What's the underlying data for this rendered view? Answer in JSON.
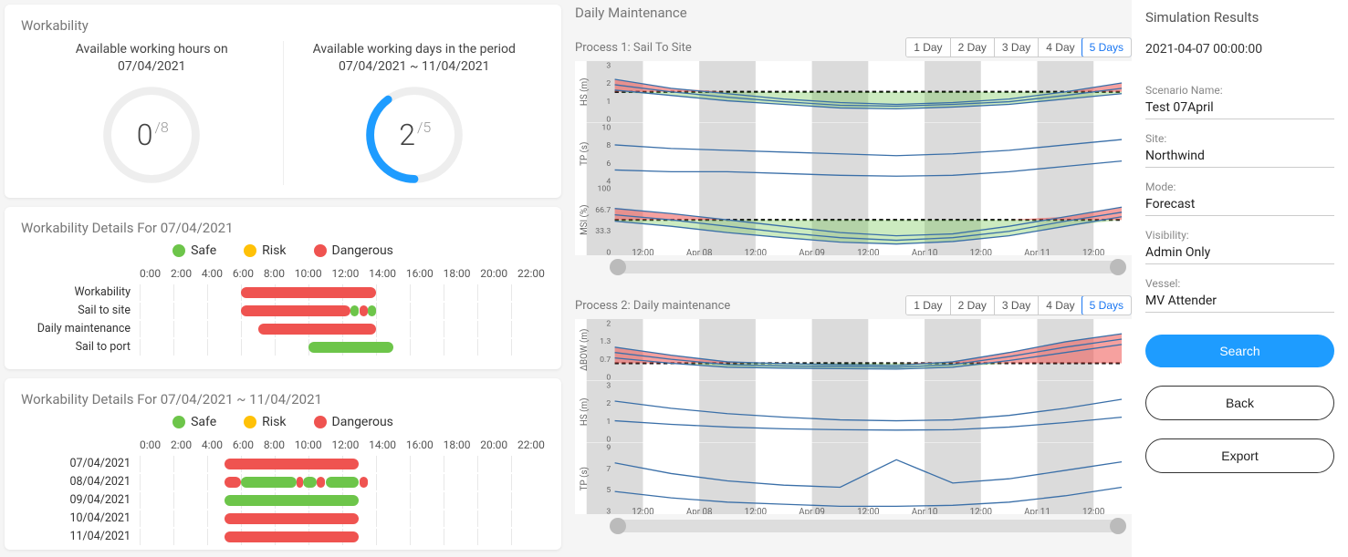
{
  "workability": {
    "title": "Workability",
    "hours_label": "Available working hours on",
    "hours_date": "07/04/2021",
    "hours_value": "0",
    "hours_total": "/8",
    "days_label": "Available working days in the period",
    "days_range": "07/04/2021 ~ 11/04/2021",
    "days_value": "2",
    "days_total": "/5"
  },
  "legend": {
    "safe": "Safe",
    "risk": "Risk",
    "dangerous": "Dangerous"
  },
  "details1": {
    "title": "Workability Details For 07/04/2021",
    "hours": [
      "0:00",
      "2:00",
      "4:00",
      "6:00",
      "8:00",
      "10:00",
      "12:00",
      "14:00",
      "16:00",
      "18:00",
      "20:00",
      "22:00"
    ],
    "rows": [
      {
        "label": "Workability",
        "segs": [
          {
            "c": "red",
            "s": 6,
            "e": 14
          }
        ]
      },
      {
        "label": "Sail to site",
        "segs": [
          {
            "c": "red",
            "s": 6,
            "e": 12.5
          },
          {
            "c": "green",
            "s": 12.5,
            "e": 13
          },
          {
            "c": "red",
            "s": 13,
            "e": 13.5
          },
          {
            "c": "green",
            "s": 13.5,
            "e": 14
          }
        ]
      },
      {
        "label": "Daily maintenance",
        "segs": [
          {
            "c": "red",
            "s": 7,
            "e": 14
          }
        ]
      },
      {
        "label": "Sail to port",
        "segs": [
          {
            "c": "green",
            "s": 10,
            "e": 15
          }
        ]
      }
    ]
  },
  "details2": {
    "title": "Workability Details For 07/04/2021 ~ 11/04/2021",
    "rows": [
      {
        "label": "07/04/2021",
        "segs": [
          {
            "c": "red",
            "s": 5,
            "e": 13
          }
        ]
      },
      {
        "label": "08/04/2021",
        "segs": [
          {
            "c": "red",
            "s": 5,
            "e": 6
          },
          {
            "c": "green",
            "s": 6,
            "e": 9.3
          },
          {
            "c": "red",
            "s": 9.3,
            "e": 9.7
          },
          {
            "c": "green",
            "s": 9.7,
            "e": 10.5
          },
          {
            "c": "red",
            "s": 10.5,
            "e": 11
          },
          {
            "c": "green",
            "s": 11,
            "e": 13
          },
          {
            "c": "red",
            "s": 13,
            "e": 13.5
          }
        ]
      },
      {
        "label": "09/04/2021",
        "segs": [
          {
            "c": "green",
            "s": 5,
            "e": 13
          }
        ]
      },
      {
        "label": "10/04/2021",
        "segs": [
          {
            "c": "red",
            "s": 5,
            "e": 13
          }
        ]
      },
      {
        "label": "11/04/2021",
        "segs": [
          {
            "c": "red",
            "s": 5,
            "e": 13
          }
        ]
      }
    ]
  },
  "maint": {
    "title": "Daily Maintenance",
    "day_buttons": [
      "1 Day",
      "2 Day",
      "3 Day",
      "4 Day",
      "5 Days"
    ],
    "active_button": "5 Days",
    "proc1_title": "Process 1: Sail To Site",
    "proc2_title": "Process 2: Daily maintenance",
    "x_ticks": [
      "12:00",
      "Apr 08",
      "12:00",
      "Apr 09",
      "12:00",
      "Apr 10",
      "12:00",
      "Apr 11",
      "12:00"
    ]
  },
  "chart_data": [
    {
      "type": "line",
      "title": "Process 1 HS(m)",
      "ylabel": "HS (m)",
      "ylim": [
        0,
        3
      ],
      "threshold": 1.5,
      "x": [
        "07 00",
        "07 12",
        "08 00",
        "08 12",
        "09 00",
        "09 12",
        "10 00",
        "10 12",
        "11 00",
        "11 12"
      ],
      "series": [
        {
          "name": "upper",
          "values": [
            2.2,
            1.7,
            1.4,
            1.1,
            0.9,
            0.8,
            0.9,
            1.1,
            1.5,
            2.0
          ]
        },
        {
          "name": "mid",
          "values": [
            1.9,
            1.5,
            1.2,
            0.95,
            0.75,
            0.7,
            0.8,
            0.95,
            1.3,
            1.7
          ]
        },
        {
          "name": "lower",
          "values": [
            1.6,
            1.3,
            1.0,
            0.8,
            0.6,
            0.55,
            0.65,
            0.8,
            1.1,
            1.4
          ]
        }
      ]
    },
    {
      "type": "line",
      "title": "Process 1 TP(s)",
      "ylabel": "TP (s)",
      "ylim": [
        4,
        10
      ],
      "x": [
        "07 00",
        "07 12",
        "08 00",
        "08 12",
        "09 00",
        "09 12",
        "10 00",
        "10 12",
        "11 00",
        "11 12"
      ],
      "series": [
        {
          "name": "upper",
          "values": [
            8,
            7.6,
            7.4,
            7.2,
            7.0,
            6.8,
            7.0,
            7.4,
            8.0,
            8.6
          ]
        },
        {
          "name": "lower",
          "values": [
            5.2,
            5.0,
            5.0,
            4.8,
            4.6,
            4.5,
            4.6,
            5.0,
            5.6,
            6.2
          ]
        }
      ]
    },
    {
      "type": "line",
      "title": "Process 1 MSI(%)",
      "ylabel": "MSI (%)",
      "ylim": [
        0,
        100
      ],
      "threshold": 50,
      "x": [
        "07 00",
        "07 12",
        "08 00",
        "08 12",
        "09 00",
        "09 12",
        "10 00",
        "10 12",
        "11 00",
        "11 12"
      ],
      "series": [
        {
          "name": "upper",
          "values": [
            68,
            60,
            50,
            40,
            30,
            25,
            28,
            40,
            55,
            70
          ]
        },
        {
          "name": "mid",
          "values": [
            58,
            50,
            40,
            30,
            22,
            18,
            22,
            32,
            48,
            62
          ]
        },
        {
          "name": "lower",
          "values": [
            48,
            40,
            30,
            22,
            15,
            12,
            16,
            25,
            40,
            55
          ]
        }
      ]
    },
    {
      "type": "line",
      "title": "Process 2 ΔBOW(m)",
      "ylabel": "ΔBOW (m)",
      "ylim": [
        0,
        2.0
      ],
      "threshold": 0.5,
      "x": [
        "07 00",
        "07 12",
        "08 00",
        "08 12",
        "09 00",
        "09 12",
        "10 00",
        "10 12",
        "11 00",
        "11 12"
      ],
      "series": [
        {
          "name": "upper",
          "values": [
            1.1,
            0.8,
            0.55,
            0.48,
            0.45,
            0.42,
            0.55,
            0.9,
            1.3,
            1.6
          ]
        },
        {
          "name": "mid",
          "values": [
            0.9,
            0.65,
            0.45,
            0.4,
            0.38,
            0.35,
            0.45,
            0.75,
            1.1,
            1.4
          ]
        },
        {
          "name": "lower",
          "values": [
            0.7,
            0.5,
            0.35,
            0.32,
            0.3,
            0.28,
            0.35,
            0.6,
            0.9,
            1.2
          ]
        }
      ]
    },
    {
      "type": "line",
      "title": "Process 2 HS(m)",
      "ylabel": "HS (m)",
      "ylim": [
        0,
        3
      ],
      "x": [
        "07 00",
        "07 12",
        "08 00",
        "08 12",
        "09 00",
        "09 12",
        "10 00",
        "10 12",
        "11 00",
        "11 12"
      ],
      "series": [
        {
          "name": "upper",
          "values": [
            2.1,
            1.7,
            1.4,
            1.2,
            1.05,
            1.0,
            1.05,
            1.3,
            1.7,
            2.2
          ]
        },
        {
          "name": "lower",
          "values": [
            1.0,
            0.8,
            0.65,
            0.55,
            0.5,
            0.48,
            0.5,
            0.65,
            0.9,
            1.2
          ]
        }
      ]
    },
    {
      "type": "line",
      "title": "Process 2 TP(s)",
      "ylabel": "TP (s)",
      "ylim": [
        3,
        9
      ],
      "x": [
        "07 00",
        "07 12",
        "08 00",
        "08 12",
        "09 00",
        "09 12",
        "10 00",
        "10 12",
        "11 00",
        "11 12"
      ],
      "series": [
        {
          "name": "upper",
          "values": [
            7.5,
            6.5,
            5.8,
            5.4,
            5.2,
            7.8,
            5.6,
            6.0,
            6.8,
            7.6
          ]
        },
        {
          "name": "lower",
          "values": [
            4.8,
            4.2,
            3.8,
            3.6,
            3.4,
            3.4,
            3.5,
            3.8,
            4.4,
            5.2
          ]
        }
      ]
    }
  ],
  "sim": {
    "title": "Simulation Results",
    "timestamp": "2021-04-07 00:00:00",
    "fields": [
      {
        "label": "Scenario Name:",
        "value": "Test 07April"
      },
      {
        "label": "Site:",
        "value": "Northwind"
      },
      {
        "label": "Mode:",
        "value": "Forecast"
      },
      {
        "label": "Visibility:",
        "value": "Admin Only"
      },
      {
        "label": "Vessel:",
        "value": "MV Attender"
      }
    ],
    "search": "Search",
    "back": "Back",
    "export": "Export"
  }
}
